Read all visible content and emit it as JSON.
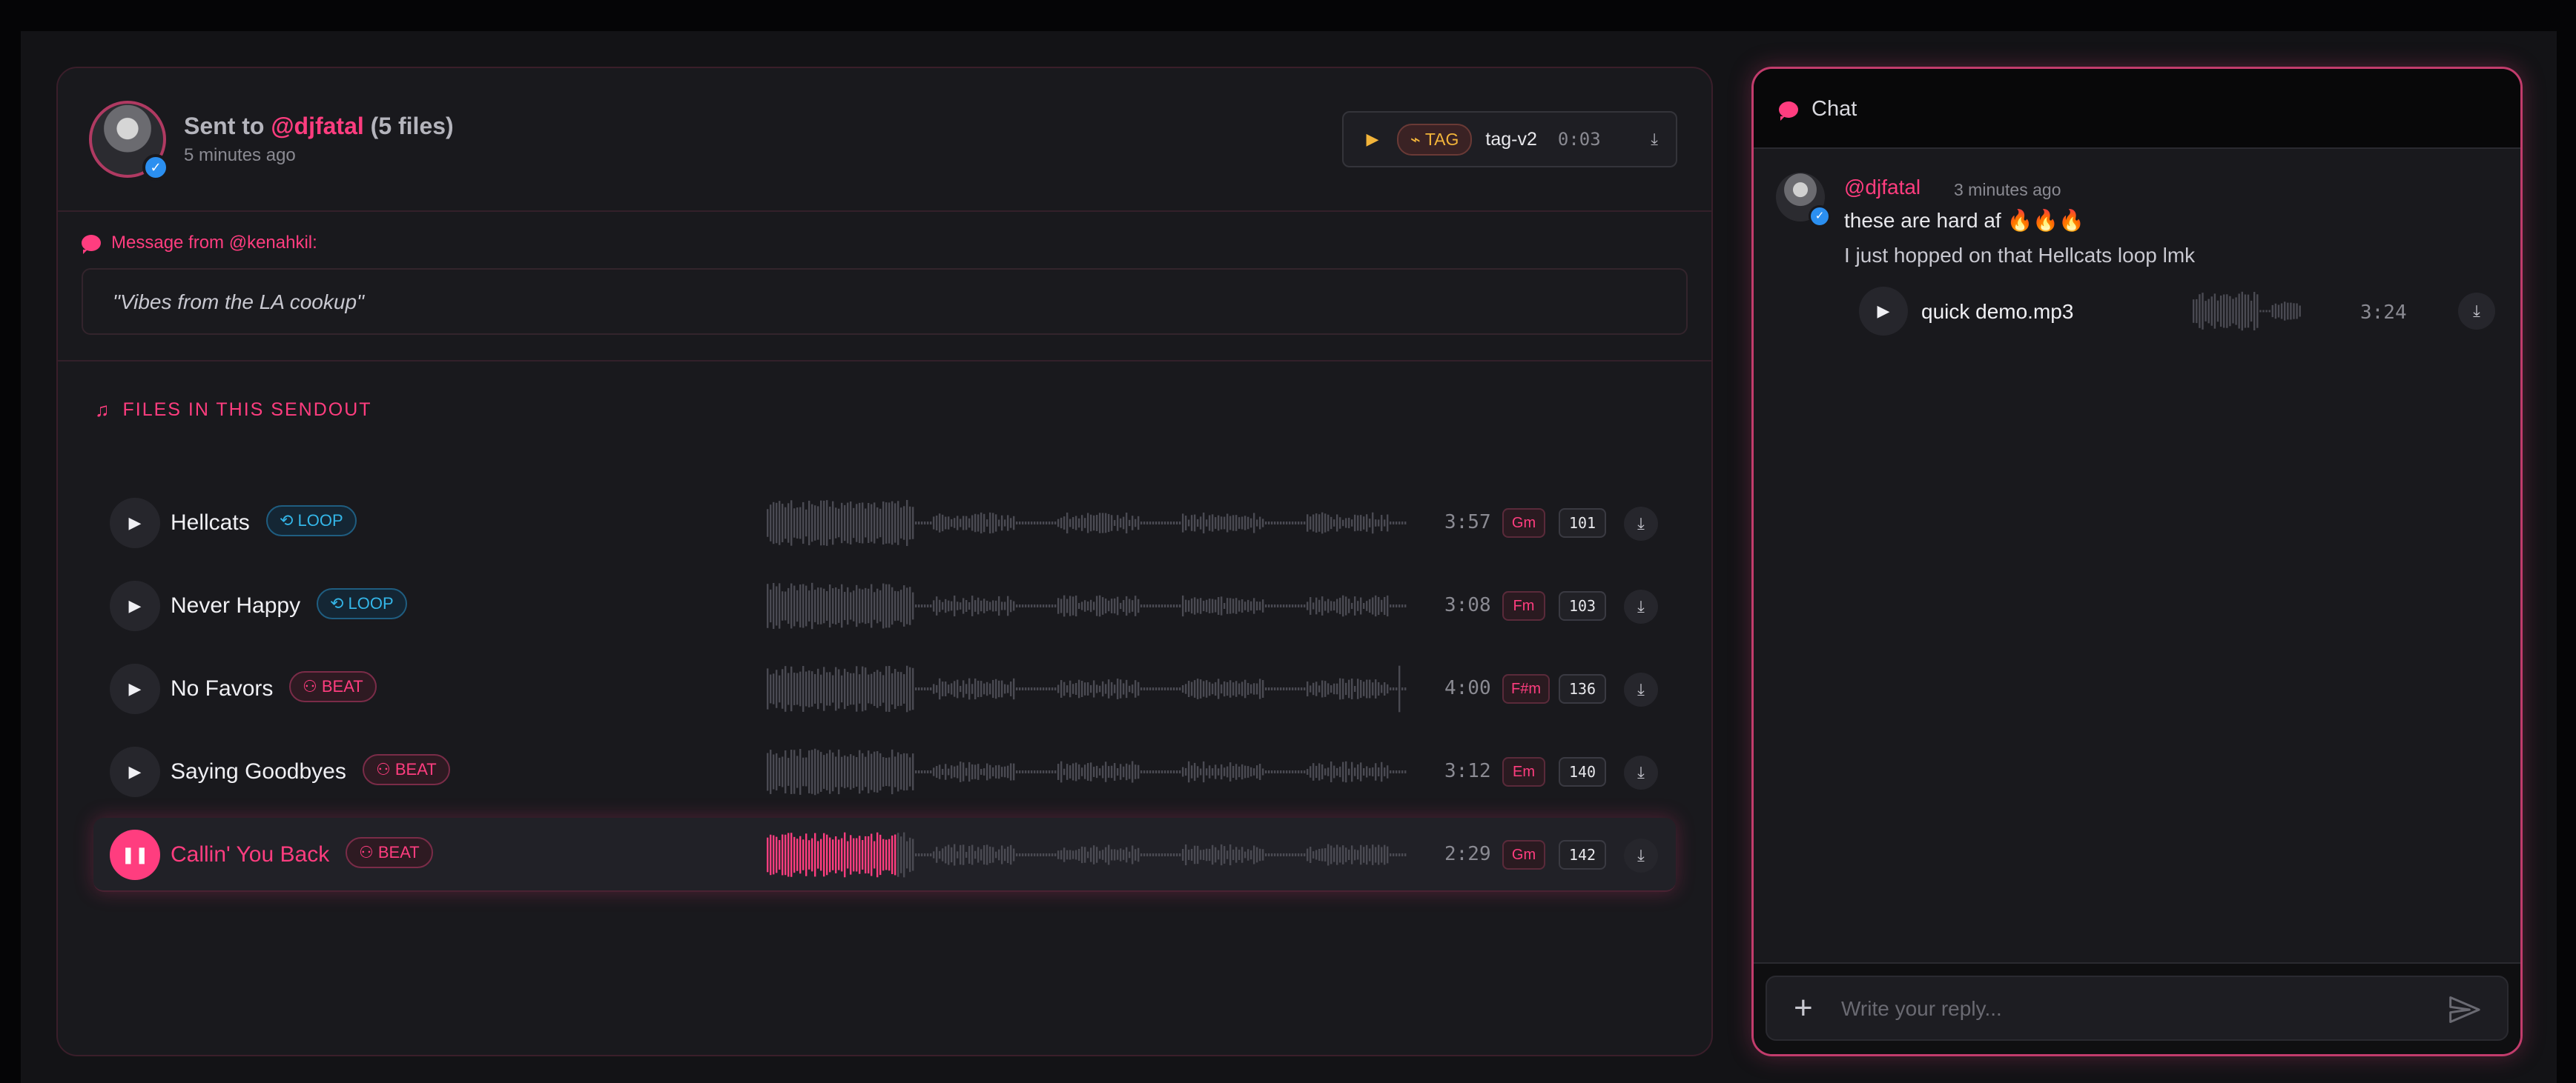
{
  "sendout": {
    "title_prefix": "Sent to",
    "recipient": "@djfatal",
    "file_count": "(5 files)",
    "sent_time": "5 minutes ago",
    "tag": {
      "play_icon": "play-icon",
      "badge_label": "TAG",
      "name": "tag-v2",
      "duration": "0:03",
      "download_icon": "download-icon"
    },
    "message_label": "Message from @kenahkil:",
    "message_text": "\"Vibes from the LA cookup\"",
    "files_title": "FILES IN THIS SENDOUT",
    "tracks": [
      {
        "name": "Hellcats",
        "type": "LOOP",
        "duration": "3:57",
        "key": "Gm",
        "bpm": "101",
        "playing": false,
        "progress": 0
      },
      {
        "name": "Never Happy",
        "type": "LOOP",
        "duration": "3:08",
        "key": "Fm",
        "bpm": "103",
        "playing": false,
        "progress": 0
      },
      {
        "name": "No Favors",
        "type": "BEAT",
        "duration": "4:00",
        "key": "F#m",
        "bpm": "136",
        "playing": false,
        "progress": 0
      },
      {
        "name": "Saying Goodbyes",
        "type": "BEAT",
        "duration": "3:12",
        "key": "Em",
        "bpm": "140",
        "playing": false,
        "progress": 0
      },
      {
        "name": "Callin' You Back",
        "type": "BEAT",
        "duration": "2:29",
        "key": "Gm",
        "bpm": "142",
        "playing": true,
        "progress": 0.2
      }
    ]
  },
  "chat": {
    "title": "Chat",
    "messages": [
      {
        "user": "@djfatal",
        "time": "3 minutes ago",
        "line1": "these are hard af 🔥🔥🔥",
        "line2": "I just hopped on that Hellcats loop lmk",
        "attachment": {
          "name": "quick demo.mp3",
          "duration": "3:24"
        }
      }
    ],
    "composer_placeholder": "Write your reply..."
  },
  "colors": {
    "accent": "#ff3d7f",
    "loop": "#34b6e8",
    "tag": "#f2b43a",
    "verified": "#2b8ff0"
  }
}
